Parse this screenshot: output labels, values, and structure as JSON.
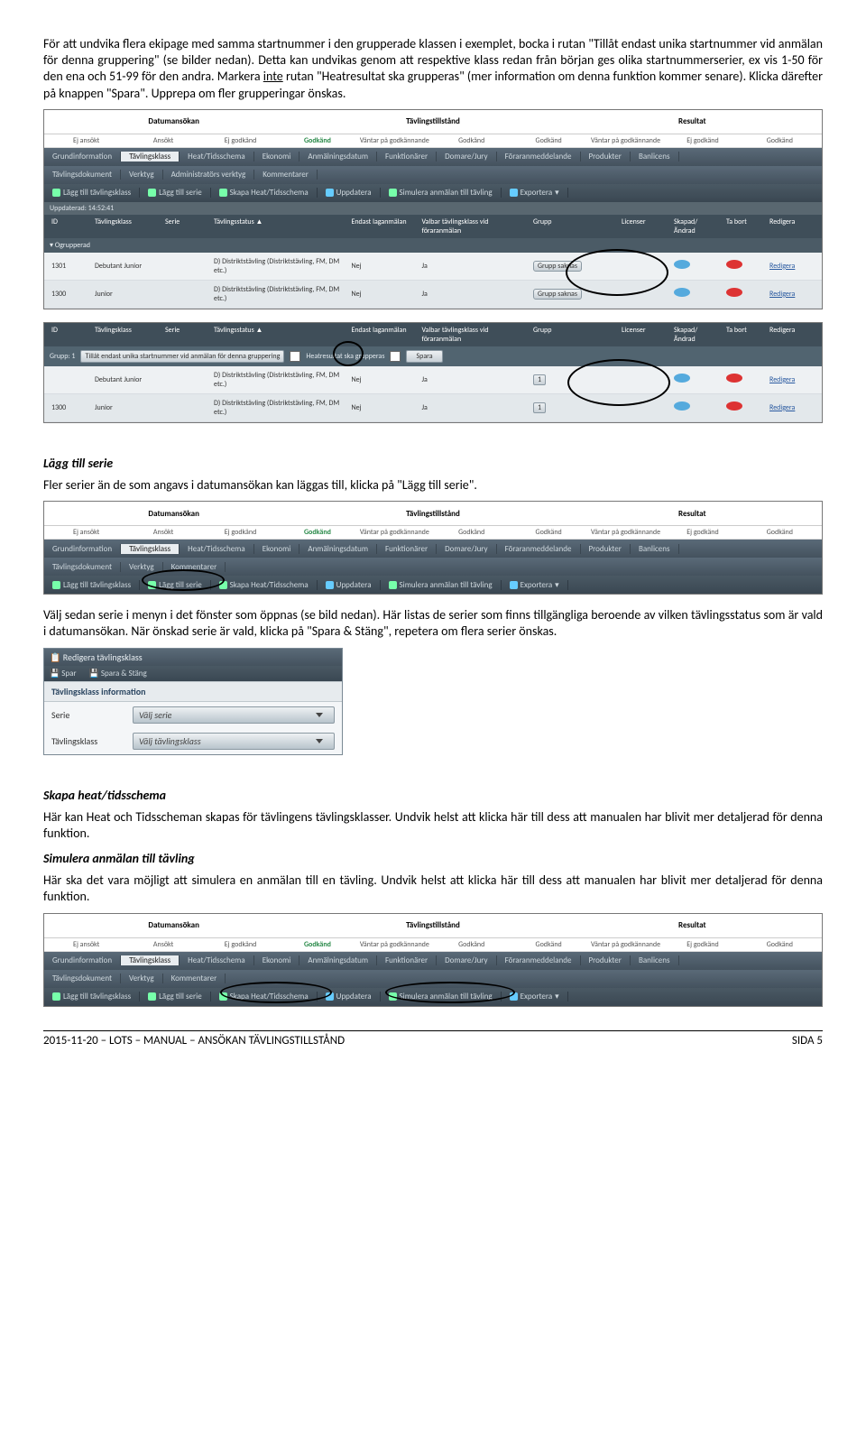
{
  "para1_a": "För att undvika flera ekipage med samma startnummer i den grupperade klassen i exemplet, bocka i rutan \"Tillåt endast unika startnummer vid anmälan för denna gruppering\" (se bilder nedan). Detta kan undvikas genom att respektive klass redan från början ges olika startnummerserier, ex vis 1-50 för den ena och 51-99 för den andra. Markera ",
  "para1_u": "inte",
  "para1_b": " rutan \"Heatresultat ska grupperas\" (mer information om denna funktion kommer senare). Klicka därefter på knappen \"Spara\". Upprepa om fler grupperingar önskas.",
  "h2": "Lägg till serie",
  "para2": "Fler serier än de som angavs i datumansökan kan läggas till, klicka på \"Lägg till serie\".",
  "para3": "Välj sedan serie i menyn i det fönster som öppnas (se bild nedan). Här listas de serier som finns tillgängliga beroende av vilken tävlingsstatus som är vald i datumansökan. När önskad serie är vald, klicka på \"Spara & Stäng\", repetera om flera serier önskas.",
  "h3": "Skapa heat/tidsschema",
  "para4": "Här kan Heat och Tidsscheman skapas för tävlingens tävlingsklasser. Undvik helst att klicka här till dess att manualen har blivit mer detaljerad för denna funktion.",
  "h4": "Simulera anmälan till tävling",
  "para5": "Här ska det vara möjligt att simulera en anmälan till en tävling. Undvik helst att klicka här till dess att manualen har blivit mer detaljerad för denna funktion.",
  "wf": {
    "c1": "Datumansökan",
    "c2": "Tävlingstillstånd",
    "c3": "Resultat",
    "s": [
      "Ej ansökt",
      "Ansökt",
      "Ej godkänd",
      "Godkänd",
      "Väntar på godkännande",
      "Godkänd",
      "Godkänd",
      "Väntar på godkännande",
      "Ej godkänd",
      "Godkänd"
    ]
  },
  "tabs": [
    "Grundinformation",
    "Tävlingsklass",
    "Heat/Tidsschema",
    "Ekonomi",
    "Anmälningsdatum",
    "Funktionärer",
    "Domare/Jury",
    "Föraranmeddelande",
    "Produkter",
    "Banlicens"
  ],
  "tabs2": [
    "Tävlingsdokument",
    "Verktyg",
    "Administratörs verktyg",
    "Kommentarer"
  ],
  "tabs2b": [
    "Tävlingsdokument",
    "Verktyg",
    "Kommentarer"
  ],
  "tool": [
    "Lägg till tävlingsklass",
    "Lägg till serie",
    "Skapa Heat/Tidsschema",
    "Uppdatera",
    "Simulera anmälan till tävling",
    "Exportera"
  ],
  "updated": "Uppdaterad: 14:52:41",
  "th": [
    "ID",
    "Tävlingsklass",
    "Serie",
    "Tävlingsstatus ▲",
    "Endast laganmälan",
    "Valbar tävlingsklass vid föraranmälan",
    "Grupp",
    "Licenser",
    "Skapad/ Ändrad",
    "Ta bort",
    "Redigera"
  ],
  "grp0": "Ogrupperad",
  "rows": [
    {
      "id": "1301",
      "tk": "Debutant Junior",
      "ts": "D) Distriktstävling (Distriktstävling, FM, DM etc.)",
      "el": "Nej",
      "vb": "Ja",
      "gr": "Grupp saknas"
    },
    {
      "id": "1300",
      "tk": "Junior",
      "ts": "D) Distriktstävling (Distriktstävling, FM, DM etc.)",
      "el": "Nej",
      "vb": "Ja",
      "gr": "Grupp saknas"
    }
  ],
  "grp1": {
    "pre": "Grupp: 1",
    "lab": "Tillåt endast unika startnummer vid anmälan för denna gruppering",
    "lab2": "Heatresultat ska grupperas",
    "btn": "Spara"
  },
  "rows2": [
    {
      "id": "",
      "tk": "Debutant Junior",
      "ts": "D) Distriktstävling (Distriktstävling, FM, DM etc.)",
      "el": "Nej",
      "vb": "Ja",
      "gr": "1"
    },
    {
      "id": "1300",
      "tk": "Junior",
      "ts": "D) Distriktstävling (Distriktstävling, FM, DM etc.)",
      "el": "Nej",
      "vb": "Ja",
      "gr": "1"
    }
  ],
  "popup": {
    "title": "Redigera tävlingsklass",
    "b1": "Spar",
    "b2": "Spara & Stäng",
    "sec": "Tävlingsklass information",
    "l1": "Serie",
    "v1": "Välj serie",
    "l2": "Tävlingsklass",
    "v2": "Välj tävlingsklass"
  },
  "redigera": "Redigera",
  "footer": {
    "l": "2015-11-20 – LOTS – MANUAL – ANSÖKAN TÄVLINGSTILLSTÅND",
    "r": "SIDA 5"
  }
}
